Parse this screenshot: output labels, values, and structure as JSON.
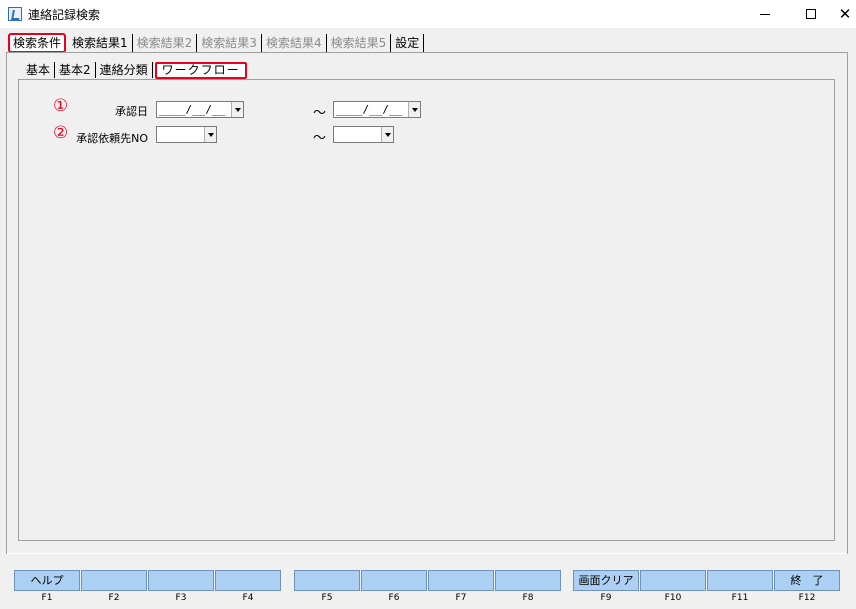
{
  "window": {
    "title": "連絡記録検索",
    "minimize_symbol": "",
    "maximize_symbol": "",
    "close_symbol": "✕"
  },
  "main_tabs": [
    {
      "label": "検索条件",
      "state": "active"
    },
    {
      "label": "検索結果1",
      "state": "enabled"
    },
    {
      "label": "検索結果2",
      "state": "disabled"
    },
    {
      "label": "検索結果3",
      "state": "disabled"
    },
    {
      "label": "検索結果4",
      "state": "disabled"
    },
    {
      "label": "検索結果5",
      "state": "disabled"
    },
    {
      "label": "設定",
      "state": "enabled"
    }
  ],
  "sub_tabs": [
    {
      "label": "基本",
      "state": "enabled"
    },
    {
      "label": "基本2",
      "state": "enabled"
    },
    {
      "label": "連絡分類",
      "state": "enabled"
    },
    {
      "label": "ワークフロー",
      "state": "active"
    }
  ],
  "form": {
    "row1": {
      "marker": "①",
      "label": "承認日",
      "from_value": "____/__/__",
      "range_symbol": "～",
      "to_value": "____/__/__"
    },
    "row2": {
      "marker": "②",
      "label": "承認依頼先NO",
      "from_value": "",
      "range_symbol": "～",
      "to_value": ""
    }
  },
  "function_keys": [
    {
      "key": "F1",
      "label": "ヘルプ"
    },
    {
      "key": "F2",
      "label": ""
    },
    {
      "key": "F3",
      "label": ""
    },
    {
      "key": "F4",
      "label": ""
    },
    {
      "key": "F5",
      "label": ""
    },
    {
      "key": "F6",
      "label": ""
    },
    {
      "key": "F7",
      "label": ""
    },
    {
      "key": "F8",
      "label": ""
    },
    {
      "key": "F9",
      "label": "画面クリア"
    },
    {
      "key": "F10",
      "label": ""
    },
    {
      "key": "F11",
      "label": ""
    },
    {
      "key": "F12",
      "label": "終　了"
    }
  ],
  "colors": {
    "highlight": "#e8001c",
    "fkey_button": "#abd0f3"
  }
}
